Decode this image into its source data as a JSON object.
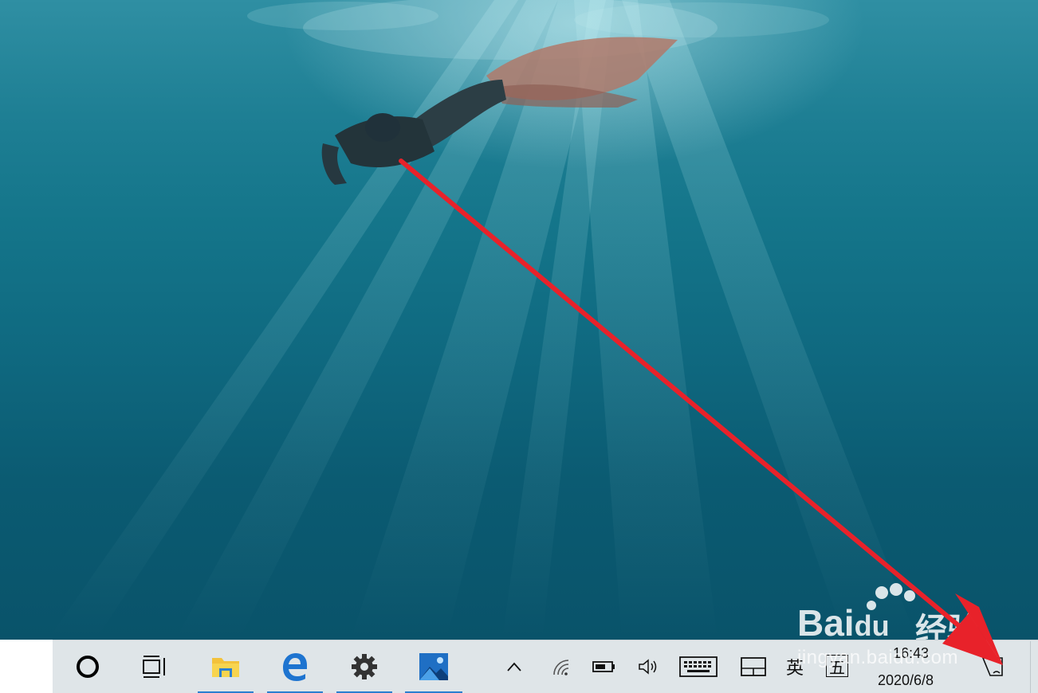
{
  "taskbar": {
    "apps": [
      {
        "name": "search",
        "icon": "cortana-circle-icon"
      },
      {
        "name": "task-view",
        "icon": "task-view-icon"
      },
      {
        "name": "file-explorer",
        "icon": "folder-icon"
      },
      {
        "name": "edge",
        "icon": "edge-icon"
      },
      {
        "name": "settings",
        "icon": "gear-icon"
      },
      {
        "name": "photos",
        "icon": "photos-icon"
      }
    ],
    "tray": {
      "show_hidden_icon": "^",
      "ime_lang": "英",
      "ime_mode": "五",
      "time": "16:43",
      "date": "2020/6/8"
    },
    "accent_color": "#2b7fd0"
  },
  "watermark": {
    "brand": "Bai",
    "brand_du": "du",
    "product": "经验",
    "url": "jingyan.baidu.com"
  },
  "annotation": {
    "arrow_color": "#e8222a"
  }
}
